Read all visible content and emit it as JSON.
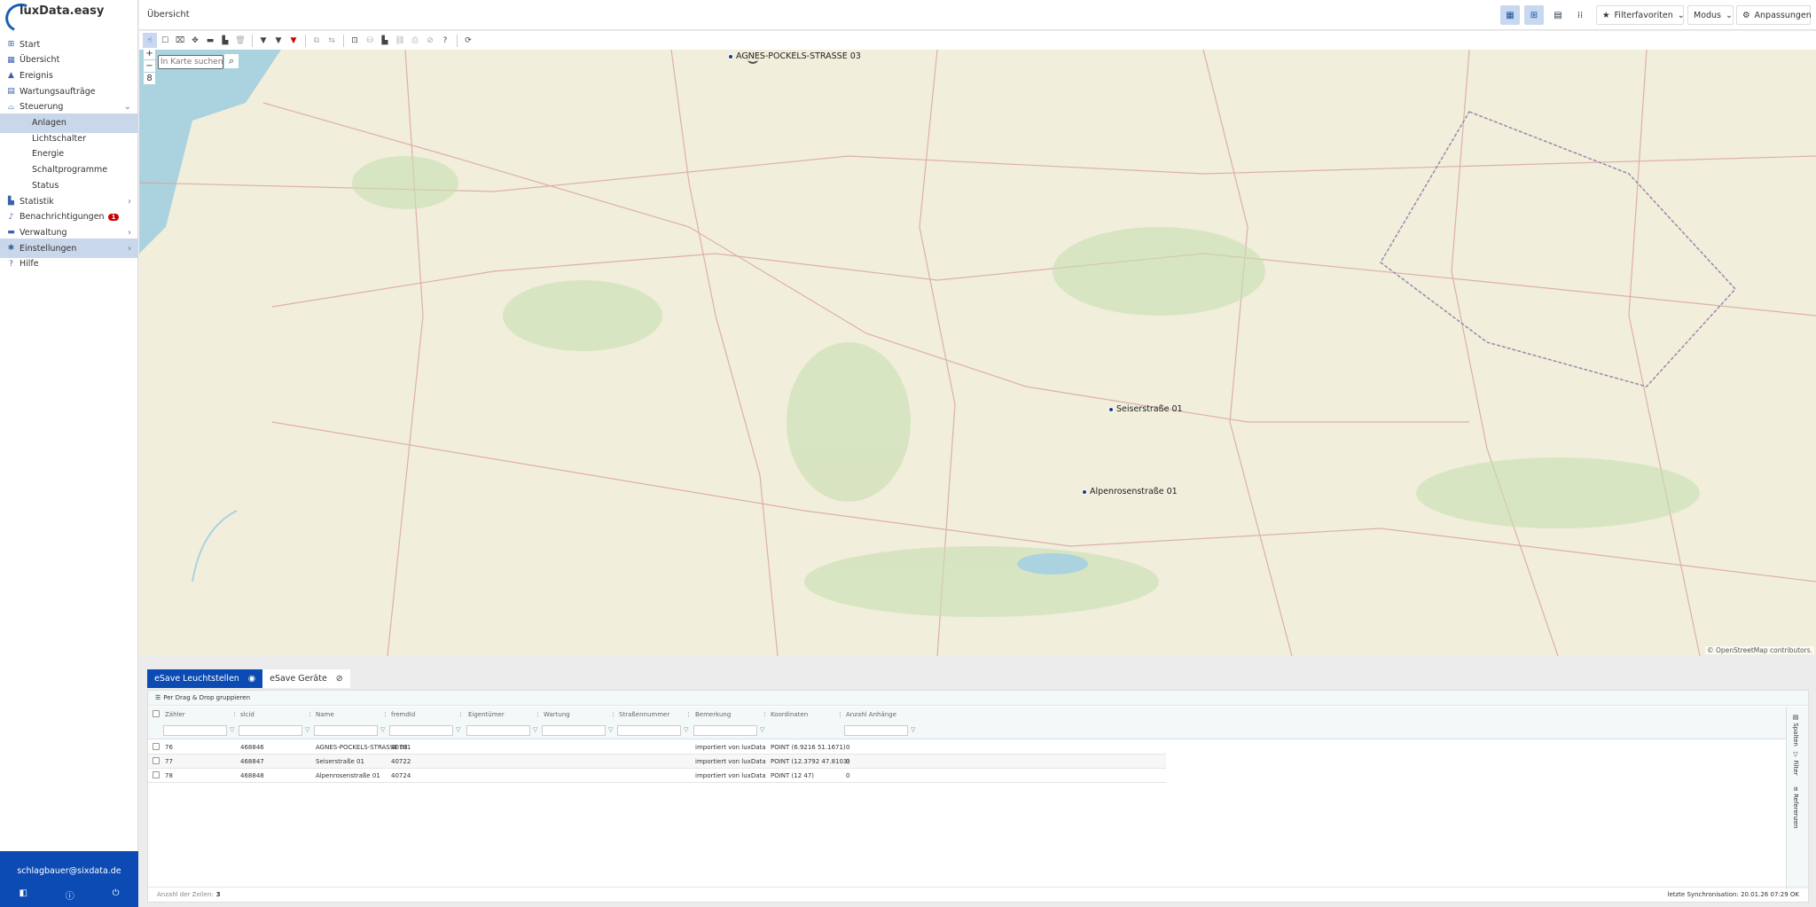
{
  "app": {
    "logo_text": "luxData.easy",
    "page_title": "Übersicht"
  },
  "sidebar": {
    "items": [
      {
        "label": "Start",
        "icon": "grid-icon"
      },
      {
        "label": "Übersicht",
        "icon": "map-icon"
      },
      {
        "label": "Ereignis",
        "icon": "warning-icon"
      },
      {
        "label": "Wartungsaufträge",
        "icon": "clipboard-icon"
      },
      {
        "label": "Steuerung",
        "icon": "lamp-icon",
        "expanded": true
      },
      {
        "label": "Anlagen",
        "selected": true
      },
      {
        "label": "Lichtschalter"
      },
      {
        "label": "Energie"
      },
      {
        "label": "Schaltprogramme"
      },
      {
        "label": "Status"
      },
      {
        "label": "Statistik",
        "icon": "chart-icon"
      },
      {
        "label": "Benachrichtigungen",
        "icon": "bell-icon",
        "badge": "1"
      },
      {
        "label": "Verwaltung",
        "icon": "briefcase-icon"
      },
      {
        "label": "Einstellungen",
        "icon": "gear-icon"
      },
      {
        "label": "Hilfe",
        "icon": "question-icon"
      }
    ],
    "user_email": "schlagbauer@sixdata.de"
  },
  "header": {
    "filter_favorites": "Filterfavoriten",
    "mode": "Modus",
    "customize": "Anpassungen"
  },
  "map": {
    "search_placeholder": "In Karte suchen... (O",
    "zoom_level": "8",
    "zoom_in": "+",
    "zoom_out": "−",
    "markers": [
      {
        "label": "AGNES-POCKELS-STRASSE 03"
      },
      {
        "label": "Seiserstraße 01"
      },
      {
        "label": "Alpenrosenstraße 01"
      }
    ],
    "attribution": "© OpenStreetMap contributors."
  },
  "tabs": [
    {
      "label": "eSave Leuchtstellen",
      "icon": "eye-icon",
      "active": true
    },
    {
      "label": "eSave Geräte",
      "icon": "eye-slash-icon"
    }
  ],
  "grid": {
    "group_hint": "Per Drag & Drop gruppieren",
    "columns": [
      "Zähler",
      "slcid",
      "Name",
      "fremdId",
      "Eigentümer",
      "Wartung",
      "Straßennummer",
      "Bemerkung",
      "Koordinaten",
      "Anzahl Anhänge"
    ],
    "rows": [
      [
        "76",
        "468846",
        "AGNES-POCKELS-STRASSE 03",
        "40781",
        "",
        "",
        "",
        "importiert von luxData",
        "POINT (6.9216 51.1671)",
        "0"
      ],
      [
        "77",
        "468847",
        "Seiserstraße 01",
        "40722",
        "",
        "",
        "",
        "importiert von luxData",
        "POINT (12.3792 47.8103)",
        "0"
      ],
      [
        "78",
        "468848",
        "Alpenrosenstraße 01",
        "40724",
        "",
        "",
        "",
        "importiert von luxData",
        "POINT (12 47)",
        "0"
      ]
    ],
    "row_count_label": "Anzahl der Zeilen:",
    "row_count": "3",
    "side_tabs": [
      "Spalten",
      "Filter",
      "Referenzen"
    ],
    "sync_label": "letzte Synchronisation:",
    "sync_value": "20.01.26 07:29 OK"
  }
}
